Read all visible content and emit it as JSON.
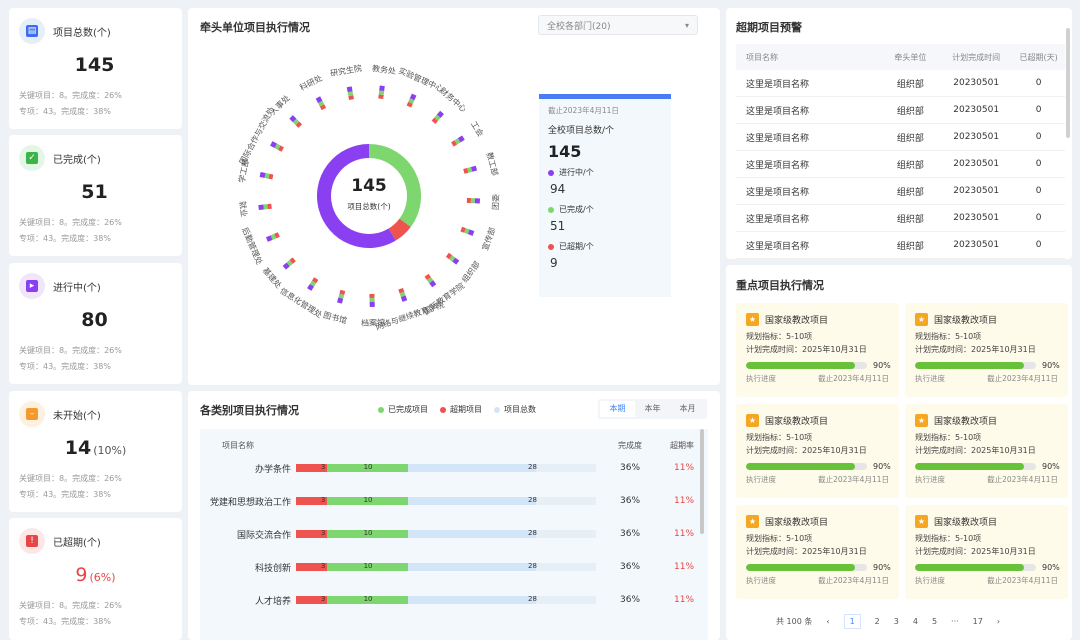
{
  "stats": [
    {
      "label": "项目总数(个)",
      "value": "145",
      "pct": "",
      "line1": "关键项目：8。完成度：26%",
      "line2": "专项：43。完成度：38%",
      "bg": "#e6eefc",
      "fg": "#3a6df0",
      "icon": "clipboard-icon",
      "glyph": "▤"
    },
    {
      "label": "已完成(个)",
      "value": "51",
      "pct": "",
      "line1": "关键项目：8。完成度：26%",
      "line2": "专项：43。完成度：38%",
      "bg": "#e4f6e6",
      "fg": "#3bb54a",
      "icon": "check-icon",
      "glyph": "✓"
    },
    {
      "label": "进行中(个)",
      "value": "80",
      "pct": "",
      "line1": "关键项目：8。完成度：26%",
      "line2": "专项：43。完成度：38%",
      "bg": "#efe6fb",
      "fg": "#8a3ff0",
      "icon": "in-progress-icon",
      "glyph": "▸"
    },
    {
      "label": "未开始(个)",
      "value": "14",
      "pct": "(10%)",
      "line1": "关键项目：8。完成度：26%",
      "line2": "专项：43。完成度：38%",
      "bg": "#fdf0e0",
      "fg": "#f29a2e",
      "icon": "not-started-icon",
      "glyph": "–"
    },
    {
      "label": "已超期(个)",
      "value": "9",
      "pct": "(6%)",
      "line1": "关键项目：8。完成度：26%",
      "line2": "专项：43。完成度：38%",
      "bg": "#fde6e6",
      "fg": "#e84545",
      "icon": "overdue-icon",
      "glyph": "!",
      "red": true
    }
  ],
  "donut_panel": {
    "title": "牵头单位项目执行情况",
    "select": "全校各部门(20)",
    "center_value": "145",
    "center_label": "项目总数(个)",
    "departments": [
      "教务处",
      "实验管理中心",
      "财务中心",
      "工会",
      "教工部",
      "团委",
      "宣传部",
      "组织部",
      "国际教育学院",
      "网络与继续教育学院",
      "档案馆",
      "图书馆",
      "信息化管理处",
      "基建处",
      "后勤管理处",
      "就业",
      "学工部",
      "国际合作与交流处",
      "人事处",
      "科研处",
      "研究生院"
    ],
    "legend_date": "截止2023年4月11日",
    "legend_total_label": "全校项目总数/个",
    "legend_total": "145",
    "legend_items": [
      {
        "label": "进行中/个",
        "value": "94",
        "color": "#8a3ff0"
      },
      {
        "label": "已完成/个",
        "value": "51",
        "color": "#7ed66f"
      },
      {
        "label": "已超期/个",
        "value": "9",
        "color": "#ef5350"
      }
    ],
    "donut": [
      {
        "value": 51,
        "color": "#7ed66f"
      },
      {
        "value": 9,
        "color": "#ef5350"
      },
      {
        "value": 85,
        "color": "#8a3ff0"
      }
    ]
  },
  "overdue": {
    "title": "超期项目预警",
    "headers": [
      "项目名称",
      "牵头单位",
      "计划完成时间",
      "已超期(天)"
    ],
    "rows": [
      [
        "这里是项目名称",
        "组织部",
        "20230501",
        "0"
      ],
      [
        "这里是项目名称",
        "组织部",
        "20230501",
        "0"
      ],
      [
        "这里是项目名称",
        "组织部",
        "20230501",
        "0"
      ],
      [
        "这里是项目名称",
        "组织部",
        "20230501",
        "0"
      ],
      [
        "这里是项目名称",
        "组织部",
        "20230501",
        "0"
      ],
      [
        "这里是项目名称",
        "组织部",
        "20230501",
        "0"
      ],
      [
        "这里是项目名称",
        "组织部",
        "20230501",
        "0"
      ]
    ]
  },
  "category": {
    "title": "各类别项目执行情况",
    "legend": [
      {
        "label": "已完成项目",
        "color": "#7ed66f"
      },
      {
        "label": "超期项目",
        "color": "#ef5350"
      },
      {
        "label": "项目总数",
        "color": "#d3e6f8"
      }
    ],
    "tabs": [
      "本期",
      "本年",
      "本月"
    ],
    "headers": [
      "项目名称",
      "完成度",
      "超期率"
    ],
    "rows": [
      {
        "name": "办学条件",
        "overdue": 3,
        "done": 10,
        "total": 28,
        "rate": "36%",
        "over": "11%"
      },
      {
        "name": "党建和思想政治工作",
        "overdue": 3,
        "done": 10,
        "total": 28,
        "rate": "36%",
        "over": "11%"
      },
      {
        "name": "国际交流合作",
        "overdue": 3,
        "done": 10,
        "total": 28,
        "rate": "36%",
        "over": "11%"
      },
      {
        "name": "科技创新",
        "overdue": 3,
        "done": 10,
        "total": 28,
        "rate": "36%",
        "over": "11%"
      },
      {
        "name": "人才培养",
        "overdue": 3,
        "done": 10,
        "total": 28,
        "rate": "36%",
        "over": "11%"
      }
    ]
  },
  "key_projects": {
    "title": "重点项目执行情况",
    "cards": [
      {
        "name": "国家级教改项目",
        "target": "规划指标：5-10项",
        "deadline": "计划完成时间：2025年10月31日",
        "progress": 90,
        "progress_text": "90%",
        "foot_left": "执行进度",
        "foot_right": "截止2023年4月11日"
      },
      {
        "name": "国家级教改项目",
        "target": "规划指标：5-10项",
        "deadline": "计划完成时间：2025年10月31日",
        "progress": 90,
        "progress_text": "90%",
        "foot_left": "执行进度",
        "foot_right": "截止2023年4月11日"
      },
      {
        "name": "国家级教改项目",
        "target": "规划指标：5-10项",
        "deadline": "计划完成时间：2025年10月31日",
        "progress": 90,
        "progress_text": "90%",
        "foot_left": "执行进度",
        "foot_right": "截止2023年4月11日"
      },
      {
        "name": "国家级教改项目",
        "target": "规划指标：5-10项",
        "deadline": "计划完成时间：2025年10月31日",
        "progress": 90,
        "progress_text": "90%",
        "foot_left": "执行进度",
        "foot_right": "截止2023年4月11日"
      },
      {
        "name": "国家级教改项目",
        "target": "规划指标：5-10项",
        "deadline": "计划完成时间：2025年10月31日",
        "progress": 90,
        "progress_text": "90%",
        "foot_left": "执行进度",
        "foot_right": "截止2023年4月11日"
      },
      {
        "name": "国家级教改项目",
        "target": "规划指标：5-10项",
        "deadline": "计划完成时间：2025年10月31日",
        "progress": 90,
        "progress_text": "90%",
        "foot_left": "执行进度",
        "foot_right": "截止2023年4月11日"
      }
    ],
    "pagination": {
      "total": "共 100 条",
      "pages": [
        "1",
        "2",
        "3",
        "4",
        "5",
        "···",
        "17"
      ]
    }
  }
}
